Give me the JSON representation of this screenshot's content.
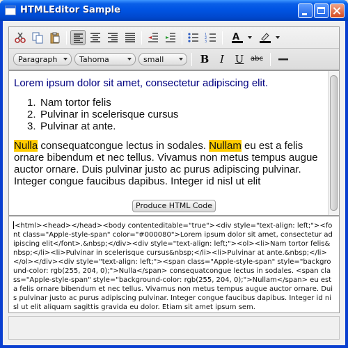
{
  "window": {
    "title": "HTMLEditor Sample",
    "minimize_icon": "minimize-icon",
    "maximize_icon": "maximize-icon",
    "close_icon": "close-icon"
  },
  "toolbar": {
    "row1": [
      "cut-icon",
      "copy-icon",
      "paste-icon",
      "align-left-icon",
      "align-center-icon",
      "align-right-icon",
      "align-justify-icon",
      "outdent-icon",
      "indent-icon",
      "bullets-icon",
      "numbering-icon",
      "font-color-icon",
      "highlight-color-icon"
    ],
    "active": "align-left-icon",
    "paragraph_format": "Paragraph",
    "font_family": "Tahoma",
    "font_size": "small",
    "bold_label": "B",
    "italic_label": "I",
    "underline_label": "U",
    "strike_label": "abc",
    "font_color": "#000000",
    "highlight_color": "#000000"
  },
  "editor": {
    "lead_line": "Lorem ipsum dolor sit amet, consectetur adipiscing elit.",
    "lead_color": "#000080",
    "list_items": [
      "Nam tortor felis",
      "Pulvinar in scelerisque cursus",
      "Pulvinar at ante."
    ],
    "list_numbers": [
      "1.",
      "2.",
      "3."
    ],
    "highlight1": "Nulla",
    "after1": " consequatcongue lectus in sodales. ",
    "highlight2": "Nullam",
    "after2": " eu est a felis ornare bibendum et nec tellus. Vivamus non metus tempus augue auctor ornare. Duis pulvinar justo ac purus adipiscing pulvinar. Integer congue faucibus dapibus. Integer id nisl ut elit",
    "highlight_color": "#ffcc00"
  },
  "produce_button": "Produce HTML Code",
  "code": "<html><head></head><body contenteditable=\"true\"><div style=\"text-align: left;\"><font class=\"Apple-style-span\" color=\"#000080\">Lorem ipsum dolor sit amet, consectetur adipiscing elit</font>.&nbsp;</div><div style=\"text-align: left;\"><ol><li>Nam tortor felis&nbsp;</li><li>Pulvinar in scelerisque cursus&nbsp;</li><li>Pulvinar at ante.&nbsp;</li></ol></div><div style=\"text-align: left;\"><span class=\"Apple-style-span\" style=\"background-color: rgb(255, 204, 0);\">Nulla</span> consequatcongue lectus in sodales. <span class=\"Apple-style-span\" style=\"background-color: rgb(255, 204, 0);\">Nullam</span> eu est a felis ornare bibendum et nec tellus. Vivamus non metus tempus augue auctor ornare. Duis pulvinar justo ac purus adipiscing pulvinar. Integer congue faucibus dapibus. Integer id nisl ut elit aliquam sagittis gravida eu dolor. Etiam sit amet ipsum sem."
}
